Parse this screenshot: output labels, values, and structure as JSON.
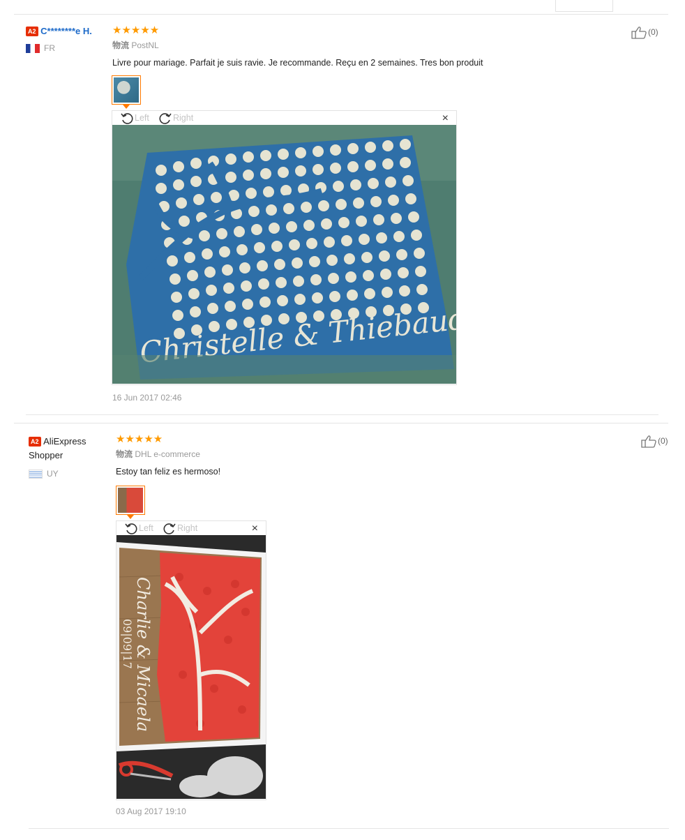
{
  "reviews": [
    {
      "level": "A2",
      "user_name": "C********e H.",
      "country": "FR",
      "stars": "★★★★★",
      "logistics_label": "物流",
      "logistics_value": "PostNL",
      "text": "Livre pour mariage. Parfait je suis ravie. Je recommande. Reçu en 2 semaines. Tres bon produit",
      "rotate_left": "Left",
      "rotate_right": "Right",
      "close": "×",
      "image_text": "Christelle & Thiebaud",
      "date": "16 Jun 2017 02:46",
      "likes": "(0)"
    },
    {
      "level": "A2",
      "user_name": "AliExpress Shopper",
      "country": "UY",
      "stars": "★★★★★",
      "logistics_label": "物流",
      "logistics_value": "DHL e-commerce",
      "text": "Estoy tan feliz es hermoso!",
      "rotate_left": "Left",
      "rotate_right": "Right",
      "close": "×",
      "image_text_1": "Charlie & Micaela",
      "image_text_2": "09|09|17",
      "date": "03 Aug 2017 19:10",
      "likes": "(0)"
    }
  ],
  "colors": {
    "star": "#ff9a00",
    "badge": "#e62e04",
    "user_link": "#1d6ac9",
    "thumb_border": "#ff7a00"
  }
}
